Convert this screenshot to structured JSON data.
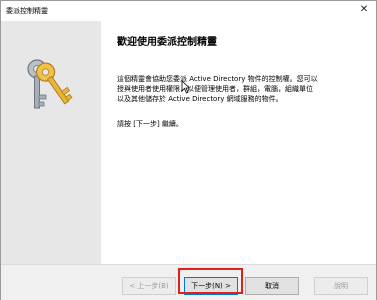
{
  "window": {
    "title": "委派控制精靈",
    "close_glyph": "✕"
  },
  "page": {
    "heading": "歡迎使用委派控制精靈",
    "description_lines": [
      "這個精靈會協助您委派 Active Directory 物件的控制權。您可以",
      "授與使用者使用權限，以便管理使用者，群組，電腦，組織單位",
      "以及其他儲存於 Active Directory 網域服務的物件。"
    ],
    "instruction": "請按 [下一步] 繼續。"
  },
  "buttons": {
    "back": "< 上一步(B)",
    "next": "下一步(N) >",
    "cancel": "取消",
    "help": "說明"
  },
  "icons": {
    "wizard_graphic": "keys-icon",
    "pointer": "mouse-cursor-icon"
  },
  "colors": {
    "highlight": "#e0201b",
    "left_pane": "#e7e7e7",
    "key_gold": "#e8b43a",
    "key_silver": "#9aa3ad"
  }
}
